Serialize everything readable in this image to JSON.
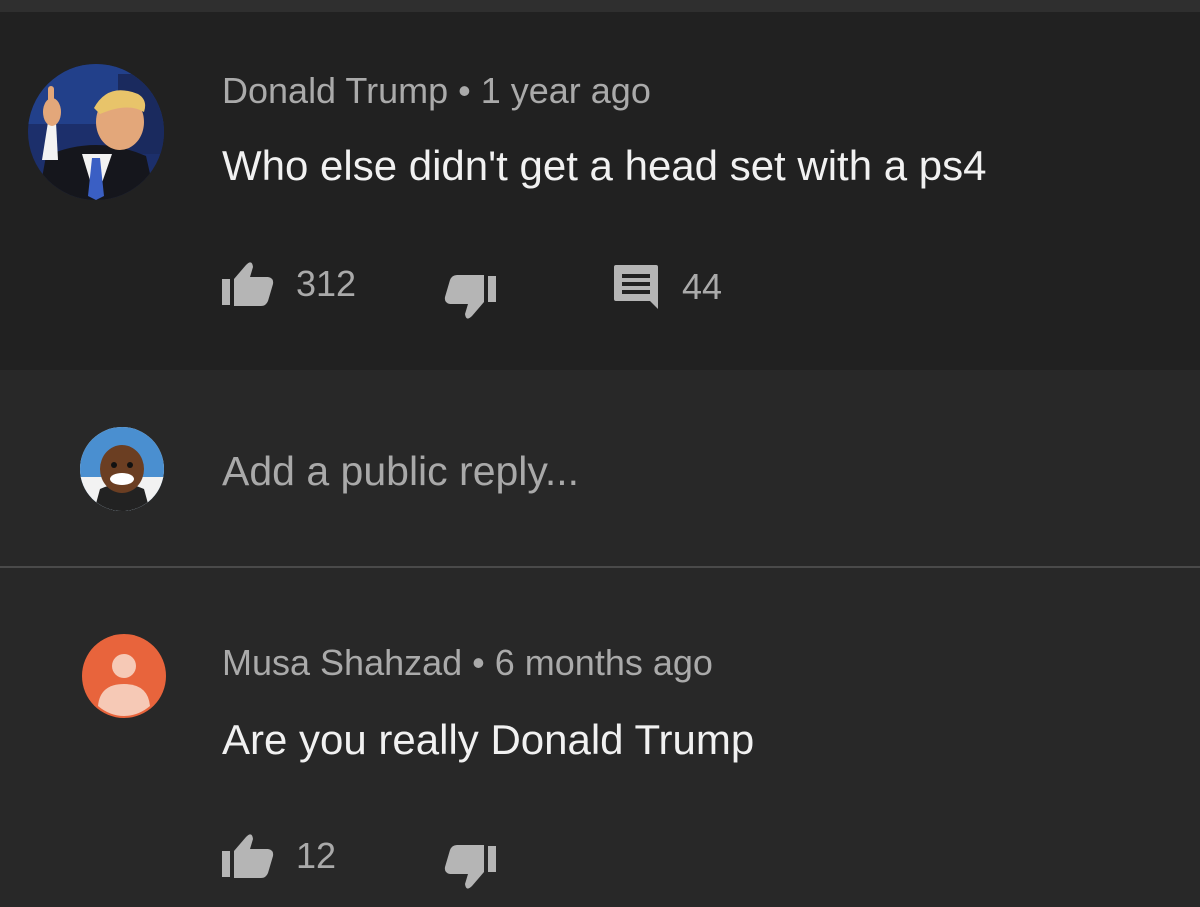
{
  "comment": {
    "author": "Donald Trump",
    "separator": "•",
    "time": "1 year ago",
    "text": "Who else didn't get a head set with a ps4",
    "likes": "312",
    "replies": "44",
    "avatar_icon": "user-photo-avatar"
  },
  "reply_input": {
    "placeholder": "Add a public reply...",
    "avatar_icon": "current-user-avatar"
  },
  "reply": {
    "author": "Musa Shahzad",
    "separator": "•",
    "time": "6 months ago",
    "text": "Are you really Donald Trump",
    "likes": "12",
    "avatar_icon": "default-user-avatar",
    "avatar_color": "#e8643c"
  },
  "icons": {
    "like": "thumbs-up-icon",
    "dislike": "thumbs-down-icon",
    "replies": "comment-icon"
  },
  "colors": {
    "background": "#212121",
    "text_primary": "#f1f1f1",
    "text_secondary": "#aaaaaa"
  }
}
